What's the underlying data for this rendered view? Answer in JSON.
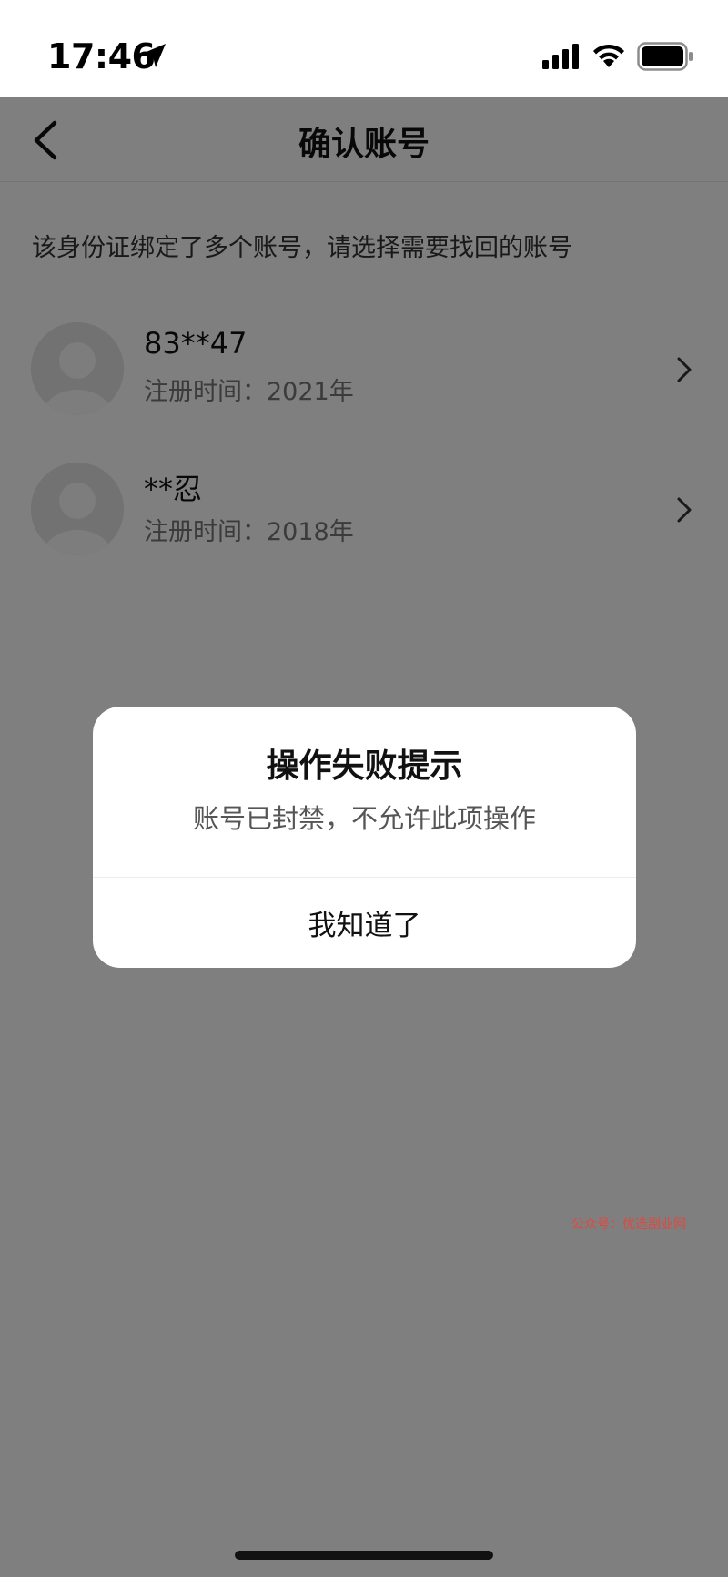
{
  "status_bar": {
    "time": "17:46"
  },
  "nav": {
    "title": "确认账号"
  },
  "hint": "该身份证绑定了多个账号，请选择需要找回的账号",
  "accounts": [
    {
      "name": "83**47",
      "registered": "注册时间：2021年"
    },
    {
      "name": "**忍",
      "registered": "注册时间：2018年"
    }
  ],
  "dialog": {
    "title": "操作失败提示",
    "message": "账号已封禁，不允许此项操作",
    "button": "我知道了"
  },
  "watermark": "公众号：优选副业网",
  "icons": {
    "back": "back-arrow-icon",
    "chevron": "chevron-right-icon",
    "location": "location-arrow-icon",
    "signal": "cellular-signal-icon",
    "wifi": "wifi-icon",
    "battery": "battery-icon"
  },
  "colors": {
    "overlay": "#000000",
    "watermark": "#e0483f"
  }
}
